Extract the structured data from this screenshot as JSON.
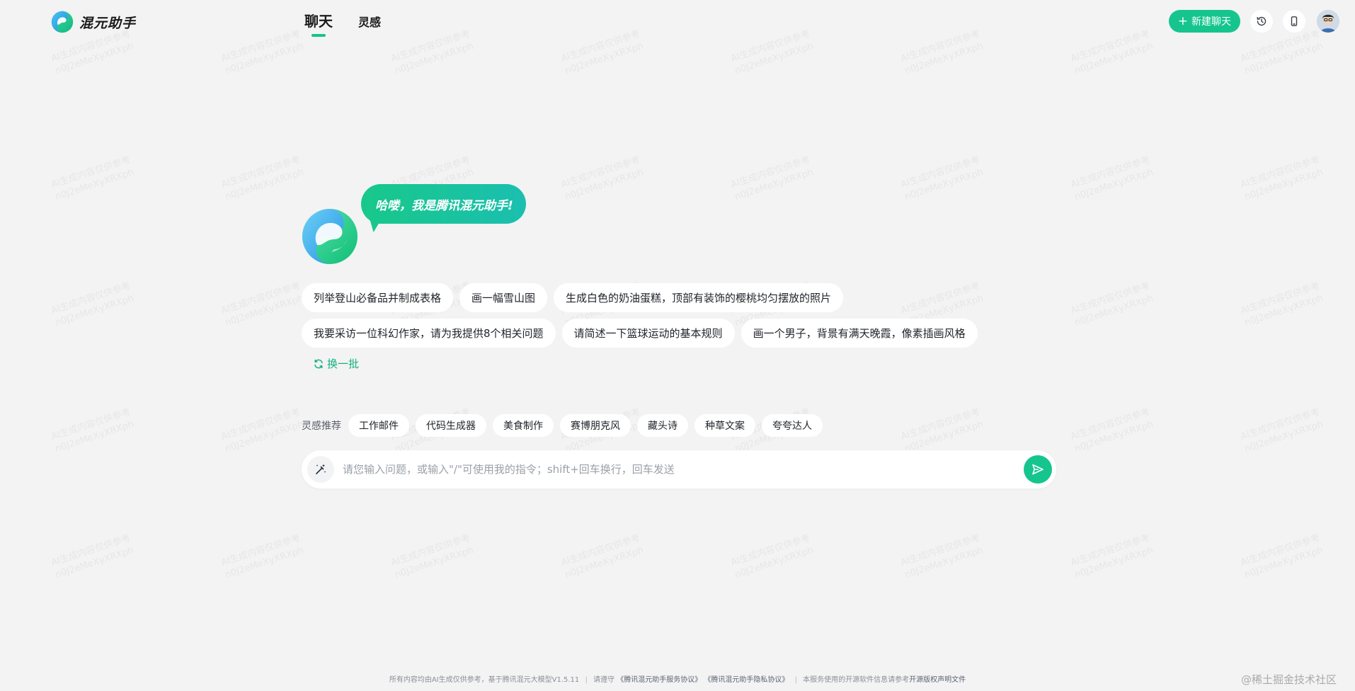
{
  "brand": {
    "name": "混元助手"
  },
  "nav": {
    "tabs": [
      "聊天",
      "灵感"
    ]
  },
  "header": {
    "new_chat_label": "新建聊天",
    "history_icon": "history-icon",
    "phone_icon": "mobile-phone-icon"
  },
  "hero": {
    "greeting": "哈喽，我是腾讯混元助手!"
  },
  "suggestions": {
    "row1": [
      "列举登山必备品并制成表格",
      "画一幅雪山图",
      "生成白色的奶油蛋糕，顶部有装饰的樱桃均匀摆放的照片"
    ],
    "row2": [
      "我要采访一位科幻作家，请为我提供8个相关问题",
      "请简述一下篮球运动的基本规则",
      "画一个男子，背景有满天晚霞，像素插画风格"
    ],
    "refresh_label": "换一批"
  },
  "inspiration": {
    "label": "灵感推荐",
    "items": [
      "工作邮件",
      "代码生成器",
      "美食制作",
      "赛博朋克风",
      "藏头诗",
      "种草文案",
      "夸夸达人"
    ]
  },
  "input": {
    "placeholder": "请您输入问题，或输入\"/\"可使用我的指令；shift+回车换行，回车发送",
    "value": ""
  },
  "footer": {
    "text1": "所有内容均由AI生成仅供参考，基于腾讯混元大模型V1.5.11",
    "text2": "请遵守",
    "link1": "《腾讯混元助手服务协议》",
    "link2": "《腾讯混元助手隐私协议》",
    "text3": "本服务使用的开源软件信息请参考",
    "link3": "开源版权声明文件"
  },
  "watermark": {
    "line1": "AI生成内容仅供参考",
    "line2": "n0J2eMeXyXRXph"
  },
  "corner_mark": "@稀土掘金技术社区",
  "colors": {
    "accent": "#16c58e",
    "background": "#f3f3f4"
  }
}
